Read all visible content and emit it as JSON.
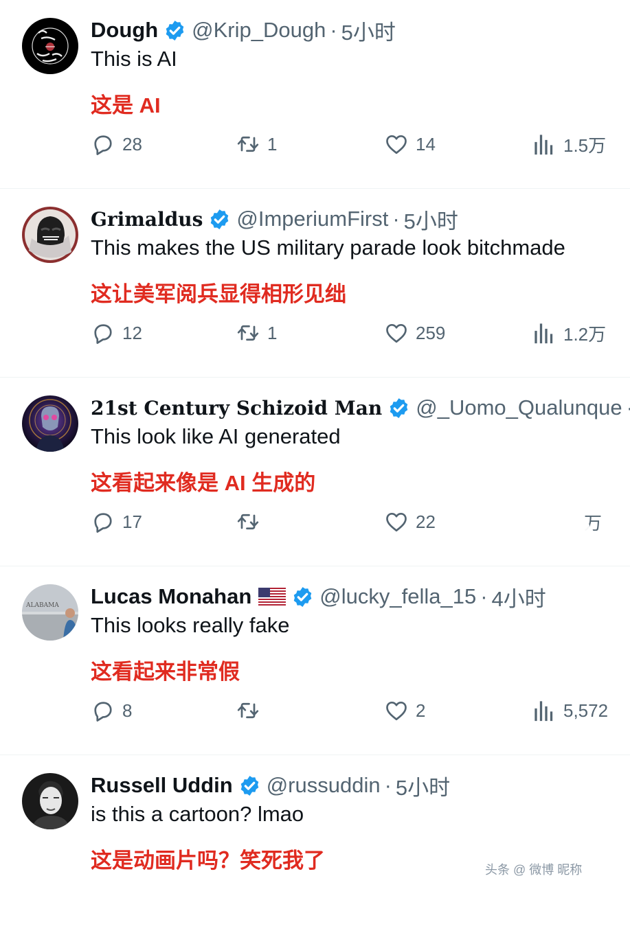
{
  "tweets": [
    {
      "name": "Dough",
      "handle": "@Krip_Dough",
      "time": "5小时",
      "text_en": "This is AI",
      "text_zh": "这是 AI",
      "reply_count": "28",
      "retweet_count": "1",
      "like_count": "14",
      "view_count": "1.5万",
      "avatar": "dark-logo-avatar"
    },
    {
      "name": "Grimaldus",
      "handle": "@ImperiumFirst",
      "time": "5小时",
      "text_en": "This makes the US military parade look bitchmade",
      "text_zh": "这让美军阅兵显得相形见绌",
      "reply_count": "12",
      "retweet_count": "1",
      "like_count": "259",
      "view_count": "1.2万",
      "avatar": "helmet-avatar"
    },
    {
      "name": "21st Century Schizoid Man",
      "handle": "@_Uomo_Qualunque",
      "time": "",
      "text_en": "This look like AI generated",
      "text_zh": "这看起来像是 AI 生成的",
      "reply_count": "17",
      "retweet_count": "",
      "like_count": "22",
      "view_count": "万",
      "avatar": "skull-avatar"
    },
    {
      "name": "Lucas Monahan",
      "handle": "@lucky_fella_15",
      "time": "4小时",
      "text_en": "This looks really fake",
      "text_zh": "这看起来非常假",
      "reply_count": "8",
      "retweet_count": "",
      "like_count": "2",
      "view_count": "5,572",
      "avatar": "photo-avatar",
      "avatar_text": "ALABAMA",
      "flag": "us-flag-icon"
    },
    {
      "name": "Russell Uddin",
      "handle": "@russuddin",
      "time": "5小时",
      "text_en": "is this a cartoon? lmao",
      "text_zh": "这是动画片吗？笑死我了",
      "avatar": "portrait-avatar"
    }
  ],
  "separator": "·",
  "watermark": "头条 @ 微博 昵称",
  "colors": {
    "translation": "#e02b20",
    "verified": "#1d9bf0",
    "secondary": "#536471"
  }
}
